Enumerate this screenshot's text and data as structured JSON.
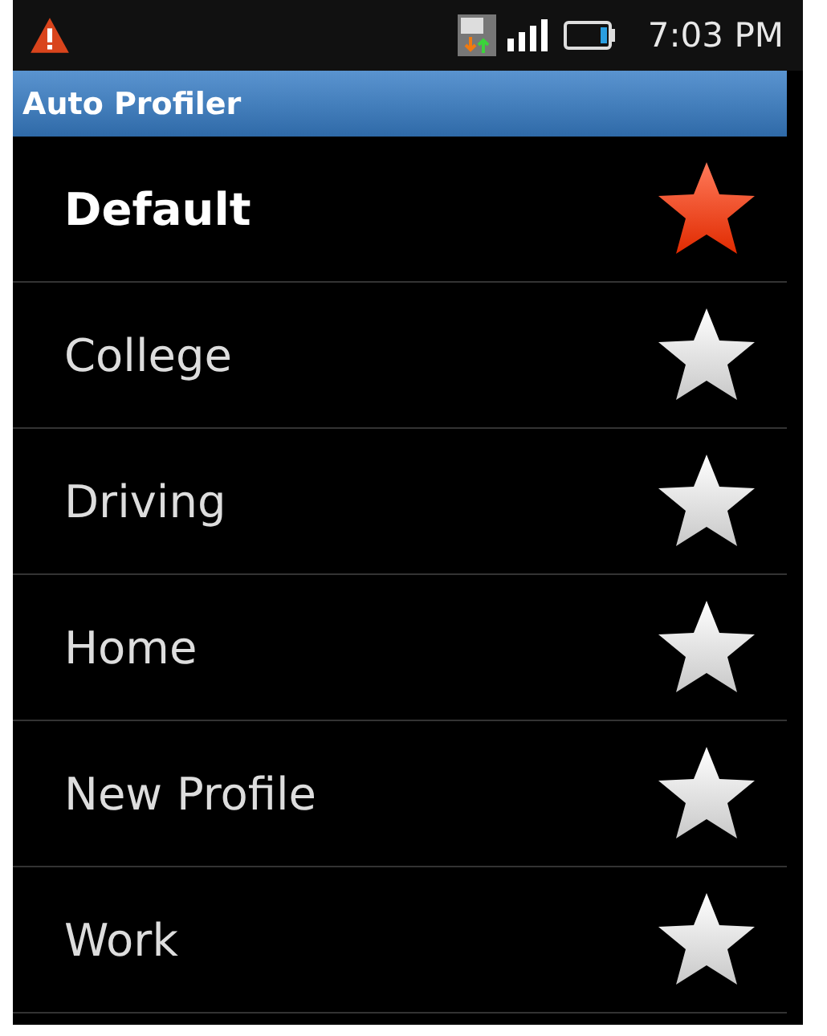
{
  "status_bar": {
    "time": "7:03 PM"
  },
  "title_bar": {
    "title": "Auto Profiler"
  },
  "profiles": [
    {
      "name": "Default",
      "selected": true
    },
    {
      "name": "College",
      "selected": false
    },
    {
      "name": "Driving",
      "selected": false
    },
    {
      "name": "Home",
      "selected": false
    },
    {
      "name": "New Profile",
      "selected": false
    },
    {
      "name": "Work",
      "selected": false
    }
  ]
}
